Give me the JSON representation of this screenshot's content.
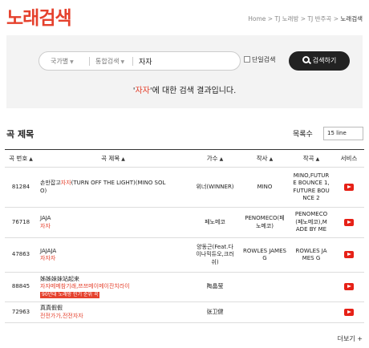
{
  "header": {
    "title": "노래검색",
    "breadcrumb": [
      "Home",
      "TJ 노래방",
      "TJ 반주곡",
      "노래검색"
    ]
  },
  "search": {
    "country_select": "국가별",
    "combined_select": "통합검색",
    "query": "자자",
    "single_search_label": "단일검색",
    "button_label": "검색하기",
    "result_prefix": "'",
    "result_keyword": "자자",
    "result_suffix": "'에 대한 검색 결과입니다."
  },
  "results": {
    "section_title": "곡 제목",
    "rows_label": "목록수",
    "rows_value": "15 line",
    "columns": [
      "곡 번호",
      "곡 제목",
      "가수",
      "작사",
      "작곡",
      "서비스"
    ],
    "rows": [
      {
        "number": "81284",
        "title_lines": [
          {
            "pre": "손만잡고",
            "hl": "자자",
            "post": "(TURN OFF THE LIGHT)(MINO SOL"
          },
          {
            "pre": "O)",
            "hl": "",
            "post": ""
          }
        ],
        "tag": "",
        "singer": "위너(WINNER)",
        "lyricist": "MINO",
        "composer": "MINO,FUTUR\nE BOUNCE 1,\nFUTURE BOU\nNCE 2"
      },
      {
        "number": "76718",
        "title_lines": [
          {
            "pre": "JAJA",
            "hl": "",
            "post": ""
          },
          {
            "pre": "",
            "hl": "자자",
            "post": ""
          }
        ],
        "tag": "",
        "singer": "페노메코",
        "lyricist": "PENOMECO(페\n노메코)",
        "composer": "PENOMECO\n(페노메코),M\nADE BY ME"
      },
      {
        "number": "47863",
        "title_lines": [
          {
            "pre": "JAJAJA",
            "hl": "",
            "post": ""
          },
          {
            "pre": "",
            "hl": "자자자",
            "post": ""
          }
        ],
        "tag": "",
        "singer": "양동근(Feat.다\n이나믹듀오,크러\n쉬)",
        "lyricist": "ROWLES JAMES\nG",
        "composer": "ROWLES JA\nMES G"
      },
      {
        "number": "88845",
        "title_lines": [
          {
            "pre": "姊姊妹妹站起来",
            "hl": "",
            "post": ""
          },
          {
            "pre": "",
            "hl": "자자메메참기래,쯔쯔메이메이잔치라이",
            "post": ""
          }
        ],
        "tag": "90년대 노래방 인기 순위 곡",
        "singer": "陶晶莹",
        "lyricist": "",
        "composer": ""
      },
      {
        "number": "72963",
        "title_lines": [
          {
            "pre": "真真假假",
            "hl": "",
            "post": ""
          },
          {
            "pre": "",
            "hl": "전전가가,전전자자",
            "post": ""
          }
        ],
        "tag": "",
        "singer": "张卫健",
        "lyricist": "",
        "composer": ""
      }
    ]
  },
  "more_label": "더보기",
  "colors": {
    "accent": "#e5412d",
    "button": "#222222",
    "youtube": "#e62117"
  }
}
